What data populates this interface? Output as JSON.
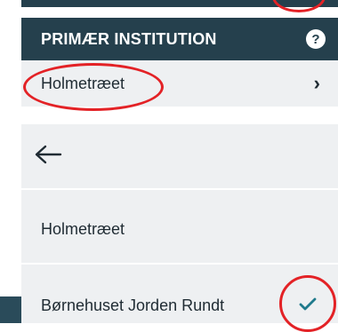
{
  "header": {
    "title": "PRIMÆR INSTITUTION",
    "help_icon": "question-mark-icon",
    "help_text": "?"
  },
  "primary_institution": {
    "value": "Holmetræet",
    "chevron_icon": "chevron-right-icon",
    "chevron_text": "›"
  },
  "selector": {
    "back_icon": "arrow-left-icon",
    "items": [
      {
        "label": "Holmetræet",
        "selected": false
      },
      {
        "label": "Børnehuset Jorden Rundt",
        "selected": true
      }
    ],
    "check_icon": "checkmark-icon"
  },
  "colors": {
    "header_bg": "#25404d",
    "row_bg": "#eef0f2",
    "accent": "#1f7a8c",
    "annotation": "#e32226"
  }
}
